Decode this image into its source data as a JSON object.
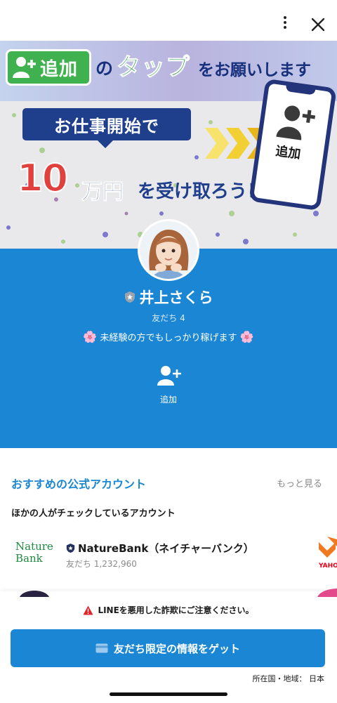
{
  "banner": {
    "badge_text": "追加",
    "request_no": "の",
    "request_tap": "タップ",
    "request_rest": "をお願いします",
    "bubble": "お仕事開始で",
    "amount_num": "10",
    "amount_unit": "万円",
    "amount_rest": "を受け取ろう！",
    "phone_add": "追加"
  },
  "profile": {
    "name": "井上さくら",
    "friends": "友だち 4",
    "status_flower": "🌸",
    "status_text": "未経験の方でもしっかり稼げます",
    "add_label": "追加",
    "background": "#1b87d4"
  },
  "recommended": {
    "title": "おすすめの公式アカウント",
    "more": "もっと見る",
    "subtitle": "ほかの人がチェックしているアカウント",
    "accounts": [
      {
        "logo_line1": "Nature",
        "logo_line2": "Bank",
        "name": "NatureBank（ネイチャーバンク）",
        "friends": "友だち 1,232,960"
      },
      {
        "logo_text": "YAHOO"
      }
    ]
  },
  "bottom": {
    "warning": "LINEを悪用した詐欺にご注意ください。",
    "cta": "友だち限定の情報をゲット",
    "region": "所在国・地域： 日本"
  },
  "colors": {
    "accent": "#1b87d4",
    "green": "#3fb14f",
    "navy": "#1f3e8c",
    "red": "#e0413e"
  },
  "icons": [
    "more-vertical-icon",
    "close-icon",
    "add-friend-icon",
    "shield-icon",
    "warning-icon",
    "card-icon"
  ]
}
